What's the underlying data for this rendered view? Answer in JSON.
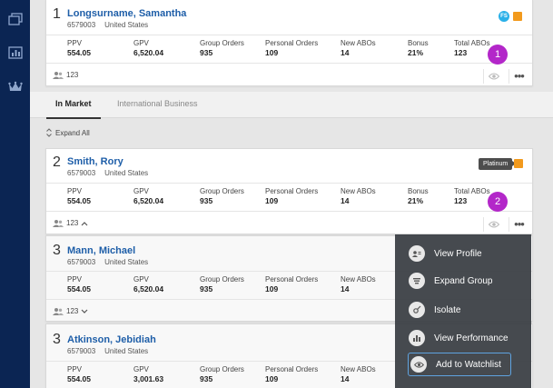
{
  "rail": {
    "icons": [
      "cards-icon",
      "chart-icon",
      "crown-icon"
    ]
  },
  "cards": [
    {
      "rank": "1",
      "name": "Longsurname, Samantha",
      "id": "6579003",
      "country": "United States",
      "initials": "FS",
      "stats": [
        {
          "label": "PPV",
          "value": "554.05"
        },
        {
          "label": "GPV",
          "value": "6,520.04"
        },
        {
          "label": "Group Orders",
          "value": "935"
        },
        {
          "label": "Personal Orders",
          "value": "109"
        },
        {
          "label": "New ABOs",
          "value": "14"
        },
        {
          "label": "Bonus",
          "value": "21%"
        },
        {
          "label": "Total ABOs",
          "value": "123"
        }
      ],
      "people_count": "123",
      "callout": "1"
    },
    {
      "rank": "2",
      "name": "Smith, Rory",
      "id": "6579003",
      "country": "United States",
      "tag": "Platinum",
      "stats": [
        {
          "label": "PPV",
          "value": "554.05"
        },
        {
          "label": "GPV",
          "value": "6,520.04"
        },
        {
          "label": "Group Orders",
          "value": "935"
        },
        {
          "label": "Personal Orders",
          "value": "109"
        },
        {
          "label": "New ABOs",
          "value": "14"
        },
        {
          "label": "Bonus",
          "value": "21%"
        },
        {
          "label": "Total ABOs",
          "value": "123"
        }
      ],
      "people_count": "123",
      "callout": "2"
    },
    {
      "rank": "3",
      "name": "Mann, Michael",
      "id": "6579003",
      "country": "United States",
      "stats": [
        {
          "label": "PPV",
          "value": "554.05"
        },
        {
          "label": "GPV",
          "value": "6,520.04"
        },
        {
          "label": "Group Orders",
          "value": "935"
        },
        {
          "label": "Personal Orders",
          "value": "109"
        },
        {
          "label": "New ABOs",
          "value": "14"
        }
      ],
      "people_count": "123"
    },
    {
      "rank": "3",
      "name": "Atkinson, Jebidiah",
      "id": "6579003",
      "country": "United States",
      "stats": [
        {
          "label": "PPV",
          "value": "554.05"
        },
        {
          "label": "GPV",
          "value": "3,001.63"
        },
        {
          "label": "Group Orders",
          "value": "935"
        },
        {
          "label": "Personal Orders",
          "value": "109"
        },
        {
          "label": "New ABOs",
          "value": "14"
        }
      ]
    }
  ],
  "tabs": {
    "active": "In Market",
    "inactive": "International Business"
  },
  "expand_all": "Expand All",
  "menu": {
    "items": [
      "View Profile",
      "Expand Group",
      "Isolate",
      "View Performance",
      "Add to Watchlist"
    ],
    "selected": "Add to Watchlist"
  },
  "colors": {
    "rail": "#0b2553",
    "link": "#1e5ea8",
    "callout": "#b327c9",
    "badge": "#f29a1d",
    "menu": "#3c4046"
  }
}
